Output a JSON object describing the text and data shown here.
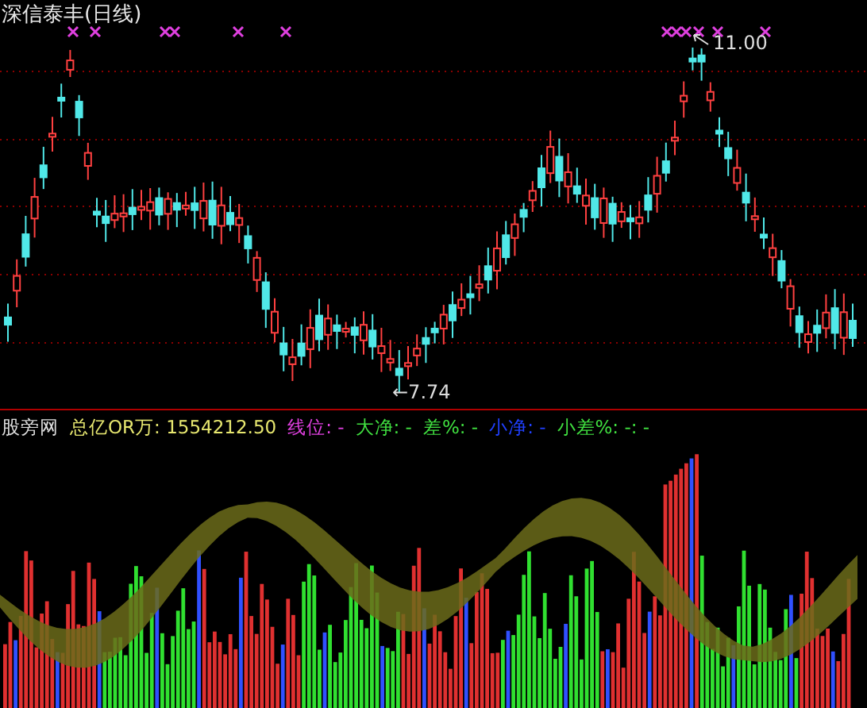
{
  "title": "深信泰丰(日线)",
  "price_chart": {
    "high_label": "11.00",
    "low_label": "←7.74"
  },
  "indicator": {
    "items": [
      {
        "text": "股旁网",
        "color": "#e0e0e0"
      },
      {
        "text": "总亿OR万: 1554212.50",
        "color": "#e8e870"
      },
      {
        "text": "线位: -",
        "color": "#e040e0"
      },
      {
        "text": "大净: -",
        "color": "#40e040"
      },
      {
        "text": "差%: -",
        "color": "#40e040"
      },
      {
        "text": "小净: -",
        "color": "#2040ff"
      },
      {
        "text": "小差%: -: -",
        "color": "#40e040"
      }
    ]
  }
}
